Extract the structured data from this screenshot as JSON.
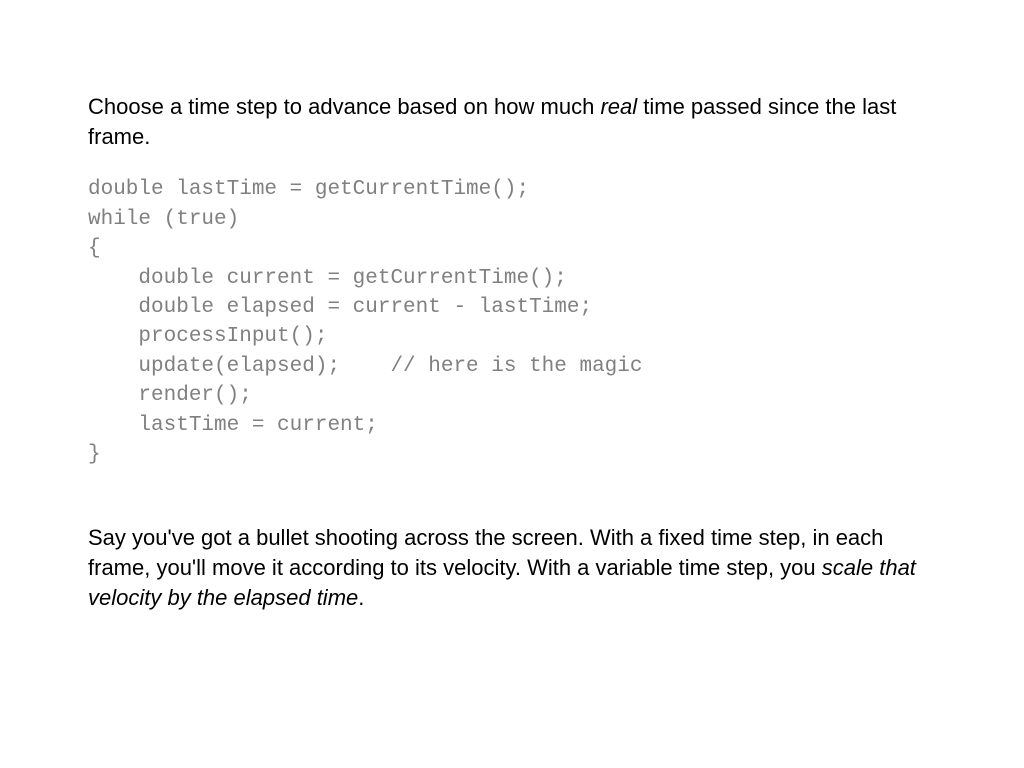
{
  "para1": {
    "before": "Choose a time step to advance based on how much ",
    "italic": "real",
    "after": " time passed since the last frame."
  },
  "code": "double lastTime = getCurrentTime();\nwhile (true)\n{\n    double current = getCurrentTime();\n    double elapsed = current - lastTime;\n    processInput();\n    update(elapsed);    // here is the magic\n    render();\n    lastTime = current;\n}",
  "para2": {
    "before": "Say you've got a bullet shooting across the screen. With a fixed time step, in each frame, you'll move it according to its velocity. With a variable time step, you ",
    "italic": "scale that velocity by the elapsed time",
    "after": "."
  }
}
